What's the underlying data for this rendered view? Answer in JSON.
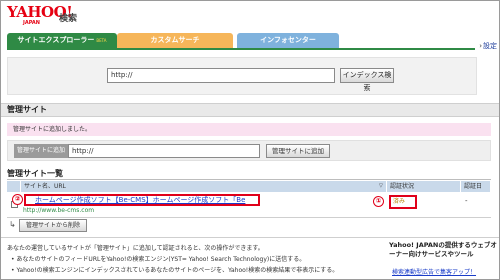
{
  "header": {
    "logo_text": "YAHOO!",
    "logo_sub": "JAPAN",
    "service_name": "検索",
    "help_link": "設定"
  },
  "tabs": [
    {
      "label": "サイトエクスプローラー",
      "badge": "BETA"
    },
    {
      "label": "カスタムサーチ"
    },
    {
      "label": "インフォセンター"
    }
  ],
  "colors": {
    "tab_active": "#2f8a45",
    "tab_custom": "#f6b65a",
    "tab_info": "#7fb2dd",
    "annotation": "#e0001a"
  },
  "search": {
    "value": "http://",
    "button_label": "インデックス検索"
  },
  "managed_sites": {
    "section_title": "管理サイト",
    "notice": "管理サイトに追加しました。",
    "add_label": "管理サイトに追加",
    "add_value": "http://",
    "add_button": "管理サイトに追加",
    "list_title": "管理サイト一覧",
    "columns": {
      "name": "サイト名、URL",
      "filter": "▽",
      "status": "認証状況",
      "date": "認証日"
    },
    "rows": [
      {
        "title": "ホームページ作成ソフト【Be-CMS】ホームページ作成ソフト「Be",
        "url": "http://www.be-cms.com",
        "status": "済み",
        "date": "-"
      }
    ],
    "delete_button": "管理サイトから削除"
  },
  "annotations": {
    "marker1": "①",
    "marker2": "②"
  },
  "info": {
    "intro": "あなたの運営しているサイトが「管理サイト」に追加して認証されると、次の操作ができます。",
    "bullets": [
      "あなたのサイトのフィードURLをYahoo!の検索エンジン(YST= Yahoo! Search Technology)に送信する。",
      "Yahoo!の検索エンジンにインデックスされているあなたのサイトのページを、Yahoo!検索の検索結果で非表示にする。"
    ]
  },
  "ad": {
    "text": "Yahoo! JAPANの提供するウェブオーナー向けサービスやツール",
    "link": "検索連動型広告で集客アップ！"
  }
}
